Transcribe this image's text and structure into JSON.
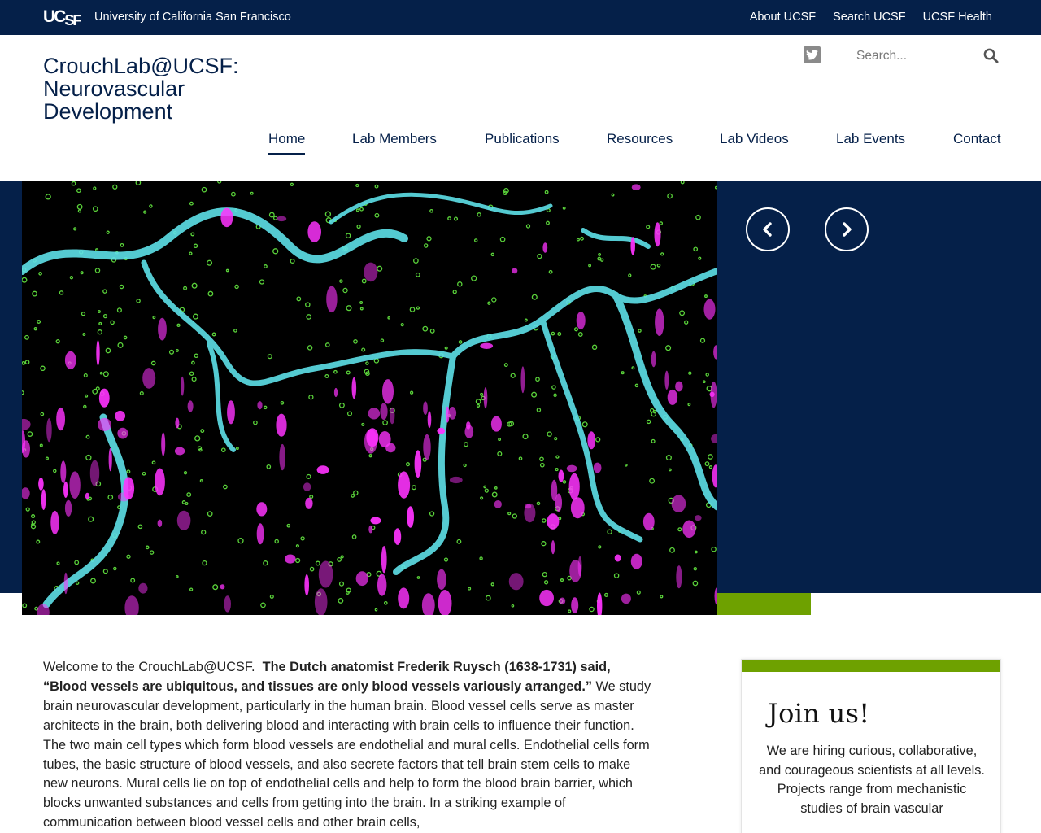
{
  "topbar": {
    "logo": "UCSF",
    "logo_part1": "UC",
    "logo_part2": "SF",
    "university": "University of California San Francisco",
    "links": [
      "About UCSF",
      "Search UCSF",
      "UCSF Health"
    ]
  },
  "header": {
    "site_title": "CrouchLab@UCSF: Neurovascular Development",
    "search_placeholder": "Search..."
  },
  "nav": {
    "items": [
      {
        "label": "Home",
        "active": true
      },
      {
        "label": "Lab Members"
      },
      {
        "label": "Publications"
      },
      {
        "label": "Resources"
      },
      {
        "label": "Lab Videos"
      },
      {
        "label": "Lab Events"
      },
      {
        "label": "Contact"
      }
    ]
  },
  "icons": {
    "twitter": "twitter-icon",
    "search": "search-icon",
    "prev": "chevron-left-icon",
    "next": "chevron-right-icon"
  },
  "colors": {
    "navy": "#052049",
    "green": "#6ea100",
    "cyan": "#5ee0e8",
    "magenta": "#ff33ff",
    "microscopy_green": "#5ad23a"
  },
  "intro": {
    "lead": "Welcome to the CrouchLab@UCSF.",
    "quote": "The Dutch anatomist Frederik Ruysch (1638-1731) said, “Blood vessels are ubiquitous, and tissues are only blood vessels variously arranged.”",
    "body": "We study brain neurovascular development, particularly in the human brain. Blood vessel cells serve as master architects in the brain, both delivering blood and interacting with brain cells to influence their function. The two main cell types which form blood vessels are endothelial and mural cells. Endothelial cells form tubes, the basic structure of blood vessels, and also secrete factors that tell brain stem cells to make new neurons. Mural cells lie on top of endothelial cells and help to form the blood brain barrier, which blocks unwanted substances and cells from getting into the brain. In a striking example of communication between blood vessel cells and other brain cells,"
  },
  "join": {
    "title": "Join us!",
    "line1": "We are hiring curious, collaborative, and courageous scientists at all levels.",
    "line2": "Projects range from mechanistic studies of brain vascular"
  }
}
